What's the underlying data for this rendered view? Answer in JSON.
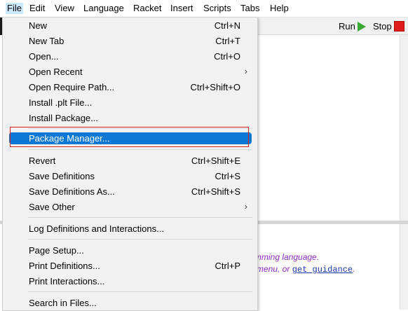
{
  "menubar": {
    "items": [
      "File",
      "Edit",
      "View",
      "Language",
      "Racket",
      "Insert",
      "Scripts",
      "Tabs",
      "Help"
    ]
  },
  "toolbar": {
    "run_label": "Run",
    "stop_label": "Stop"
  },
  "file_menu": {
    "items": [
      {
        "label": "New",
        "shortcut": "Ctrl+N"
      },
      {
        "label": "New Tab",
        "shortcut": "Ctrl+T"
      },
      {
        "label": "Open...",
        "shortcut": "Ctrl+O"
      },
      {
        "label": "Open Recent",
        "shortcut": ""
      },
      {
        "label": "Open Require Path...",
        "shortcut": "Ctrl+Shift+O"
      },
      {
        "label": "Install .plt File...",
        "shortcut": ""
      },
      {
        "label": "Install Package...",
        "shortcut": ""
      },
      {
        "label": "Package Manager...",
        "shortcut": ""
      },
      {
        "label": "Revert",
        "shortcut": "Ctrl+Shift+E"
      },
      {
        "label": "Save Definitions",
        "shortcut": "Ctrl+S"
      },
      {
        "label": "Save Definitions As...",
        "shortcut": "Ctrl+Shift+S"
      },
      {
        "label": "Save Other",
        "shortcut": ""
      },
      {
        "label": "Log Definitions and Interactions...",
        "shortcut": ""
      },
      {
        "label": "Page Setup...",
        "shortcut": ""
      },
      {
        "label": "Print Definitions...",
        "shortcut": "Ctrl+P"
      },
      {
        "label": "Print Interactions...",
        "shortcut": ""
      },
      {
        "label": "Search in Files...",
        "shortcut": ""
      }
    ],
    "submenu_arrow": "›"
  },
  "interactions": {
    "line1": "mming language.",
    "line2_prefix": "menu, or ",
    "line2_link": "get guidance",
    "line2_suffix": "."
  },
  "colors": {
    "highlight": "#0a78d4",
    "callout_border": "#d32027",
    "run_green": "#3ba935",
    "stop_red": "#e01b1b",
    "welcome_purple": "#8e2bc2"
  }
}
